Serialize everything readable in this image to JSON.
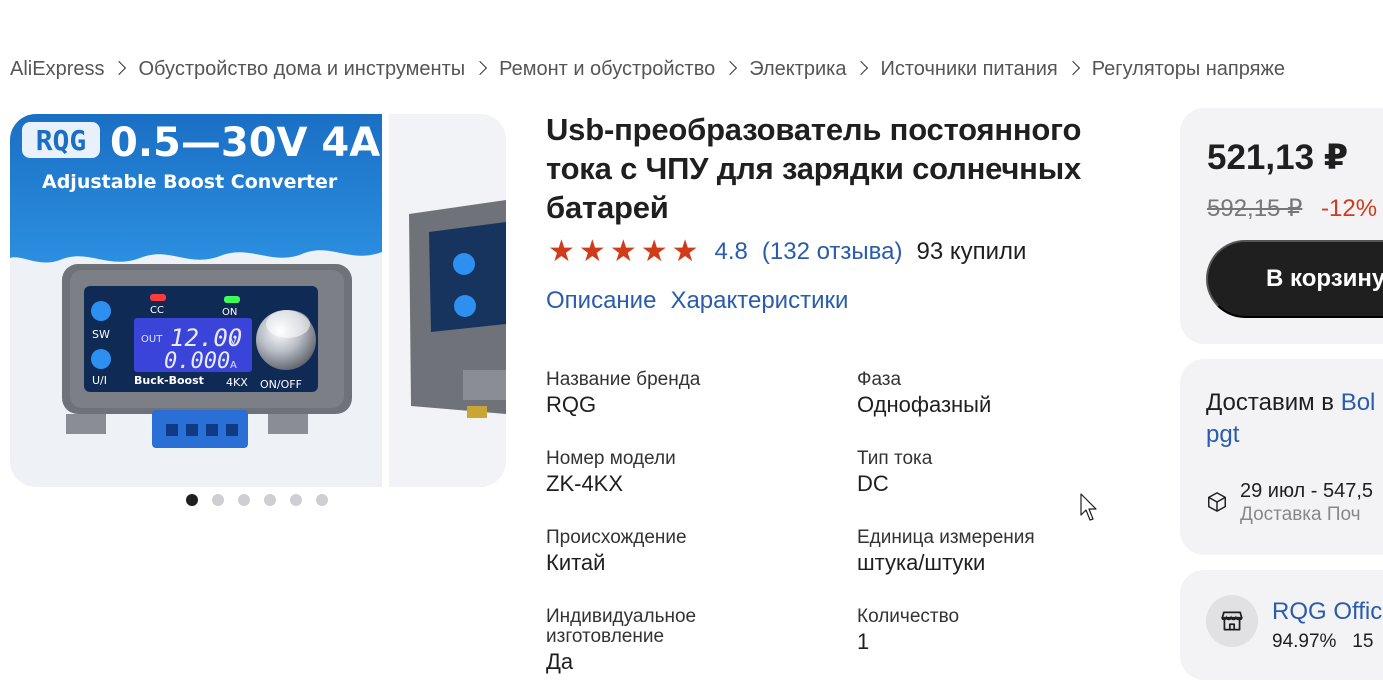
{
  "breadcrumb": [
    "AliExpress",
    "Обустройство дома и инструменты",
    "Ремонт и обустройство",
    "Электрика",
    "Источники питания",
    "Регуляторы напряже"
  ],
  "gallery": {
    "brand_badge": "RQG",
    "headline": "0.5—30V 4A",
    "subtitle": "Adjustable Boost Converter",
    "lcd_out": "OUT",
    "lcd_voltage": "12.00",
    "lcd_current": "0.000",
    "lcd_unit_v": "V",
    "lcd_unit_a": "A",
    "label_cc": "CC",
    "label_on": "ON",
    "label_sw": "SW",
    "label_ui": "U/I",
    "label_buck_boost": "Buck-Boost",
    "label_model": "4KX",
    "label_onoff": "ON/OFF",
    "dots_total": 6,
    "dots_active": 1
  },
  "product": {
    "title": "Usb-преобразователь постоянного тока с ЧПУ для зарядки солнечных батарей",
    "rating": "4.8",
    "reviews": "(132 отзыва)",
    "bought": "93 купили",
    "stars": 5,
    "tabs": [
      "Описание",
      "Характеристики"
    ]
  },
  "specs": [
    {
      "label": "Название бренда",
      "value": "RQG"
    },
    {
      "label": "Фаза",
      "value": "Однофазный"
    },
    {
      "label": "Номер модели",
      "value": "ZK-4KX"
    },
    {
      "label": "Тип тока",
      "value": "DC"
    },
    {
      "label": "Происхождение",
      "value": "Китай"
    },
    {
      "label": "Единица измерения",
      "value": "штука/штуки"
    },
    {
      "label": "Индивидуальное изготовление",
      "value": "Да"
    },
    {
      "label": "Количество",
      "value": "1"
    }
  ],
  "price_card": {
    "price": "521,13 ₽",
    "old_price": "592,15 ₽",
    "discount": "-12%",
    "cart_button": "В корзину"
  },
  "delivery_card": {
    "deliver_prefix": "Доставим в",
    "deliver_place": "Bol",
    "deliver_place_cont": "pgt",
    "date_line": "29 июл - 547,5",
    "service": "Доставка Поч"
  },
  "shop_card": {
    "name": "RQG Offic",
    "rating": "94.97%",
    "extra": "15"
  },
  "colors": {
    "accent_link": "#2a5cad",
    "price_red": "#d13b1a",
    "button_dark": "#1f1f1f",
    "card_bg": "#f3f3f5"
  }
}
